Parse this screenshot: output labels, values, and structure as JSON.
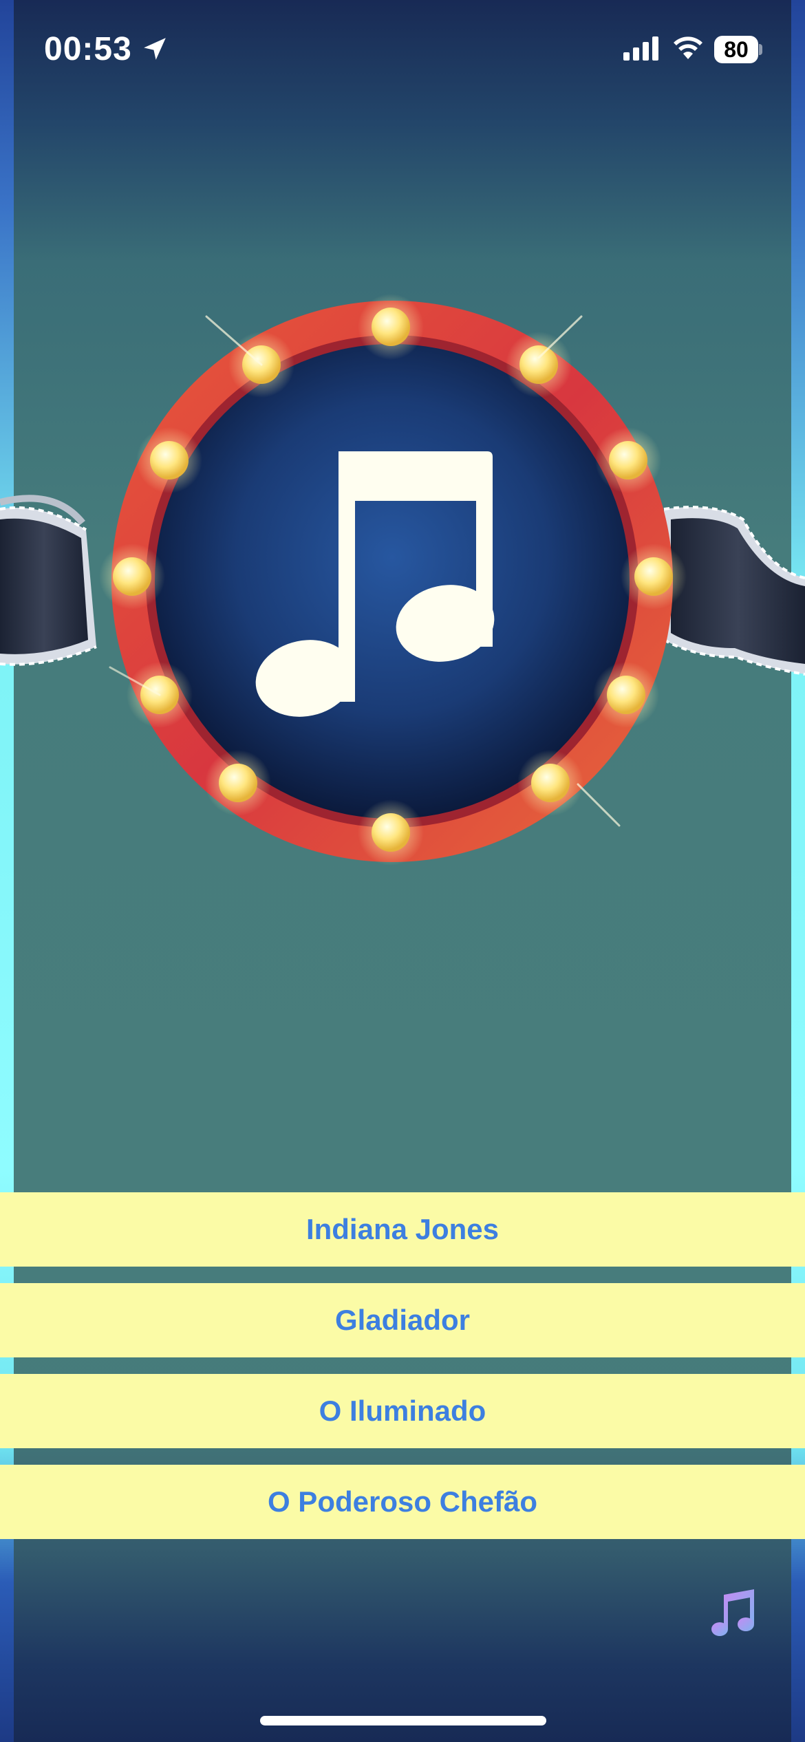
{
  "status_bar": {
    "time": "00:53",
    "battery": "80",
    "location_icon": "location-arrow-icon",
    "signal_icon": "cellular-signal-icon",
    "wifi_icon": "wifi-icon"
  },
  "artwork": {
    "icon": "music-note-icon",
    "decoration": "marquee-lights-ring-with-film-reel"
  },
  "answers": [
    {
      "label": "Indiana Jones"
    },
    {
      "label": "Gladiador"
    },
    {
      "label": "O Iluminado"
    },
    {
      "label": "O Poderoso Chefão"
    }
  ],
  "music_button": {
    "icon": "music-notes-icon"
  },
  "colors": {
    "answer_background": "#fbfba6",
    "answer_text": "#3d7fe0",
    "ring": "#d8413f",
    "disc": "#1f3f7a"
  }
}
